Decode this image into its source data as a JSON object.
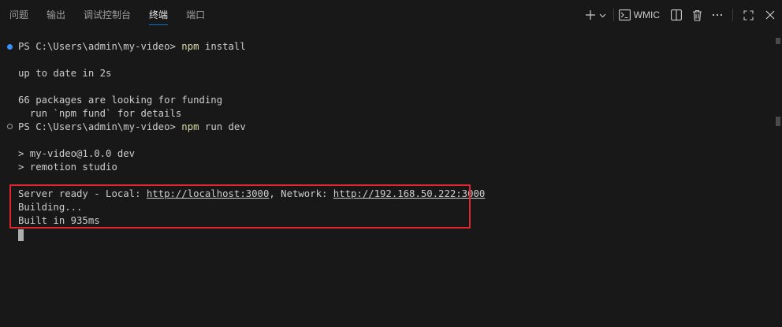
{
  "panel": {
    "tabs": [
      {
        "label": "问题",
        "active": false
      },
      {
        "label": "输出",
        "active": false
      },
      {
        "label": "调试控制台",
        "active": false
      },
      {
        "label": "终端",
        "active": true
      },
      {
        "label": "端口",
        "active": false
      }
    ],
    "actions": {
      "profile_label": "WMIC",
      "add_icon": "plus-icon",
      "dropdown_icon": "chevron-down-icon",
      "terminal_icon": "terminal-icon",
      "split_icon": "split-editor-icon",
      "kill_icon": "trash-icon",
      "more_icon": "ellipsis-icon",
      "maximize_icon": "maximize-icon",
      "close_icon": "close-icon"
    }
  },
  "terminal": {
    "line1": {
      "prompt": "PS C:\\Users\\admin\\my-video> ",
      "cmd": "npm",
      "args": " install"
    },
    "line2": "up to date in 2s",
    "line3": "66 packages are looking for funding",
    "line4": "  run `npm fund` for details",
    "line5": {
      "prompt": "PS C:\\Users\\admin\\my-video> ",
      "cmd": "npm",
      "args": " run dev"
    },
    "line6": "> my-video@1.0.0 dev",
    "line7": "> remotion studio",
    "line8": {
      "prefix": "Server ready - Local: ",
      "local_url": "http://localhost:3000",
      "mid": ", Network: ",
      "network_url": "http://192.168.50.222:3000"
    },
    "line9": "Building...",
    "line10": "Built in 935ms"
  },
  "colors": {
    "background": "#181818",
    "accent": "#0078d4",
    "command": "#dcdcaa",
    "highlight_box": "#e0262f"
  }
}
